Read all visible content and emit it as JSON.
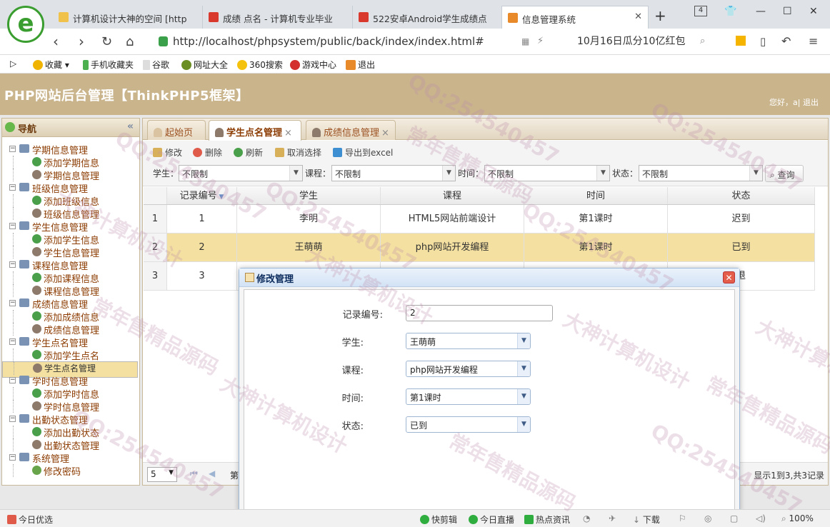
{
  "browser": {
    "tabs": [
      {
        "label": "计算机设计大神的空间 [http",
        "color": "#f0c14b"
      },
      {
        "label": "成绩 点名 - 计算机专业毕业",
        "color": "#d9382c"
      },
      {
        "label": "522安卓Android学生成绩点",
        "color": "#d9382c"
      },
      {
        "label": "信息管理系统",
        "color": "#e88a2a"
      }
    ],
    "new_tab": "+",
    "url": "http://localhost/phpsystem/public/back/index/index.html#",
    "search_text": "10月16日瓜分10亿红包",
    "bookmarks": [
      "收藏",
      "手机收藏夹",
      "谷歌",
      "网址大全",
      "360搜索",
      "游戏中心",
      "退出"
    ]
  },
  "app": {
    "title": "PHP网站后台管理【ThinkPHP5框架】",
    "greeting": "您好，a| 退出"
  },
  "nav": {
    "title": "导航",
    "groups": [
      {
        "label": "学期信息管理",
        "items": [
          "添加学期信息",
          "学期信息管理"
        ]
      },
      {
        "label": "班级信息管理",
        "items": [
          "添加班级信息",
          "班级信息管理"
        ]
      },
      {
        "label": "学生信息管理",
        "items": [
          "添加学生信息",
          "学生信息管理"
        ]
      },
      {
        "label": "课程信息管理",
        "items": [
          "添加课程信息",
          "课程信息管理"
        ]
      },
      {
        "label": "成绩信息管理",
        "items": [
          "添加成绩信息",
          "成绩信息管理"
        ]
      },
      {
        "label": "学生点名管理",
        "items": [
          "添加学生点名",
          "学生点名管理"
        ]
      },
      {
        "label": "学时信息管理",
        "items": [
          "添加学时信息",
          "学时信息管理"
        ]
      },
      {
        "label": "出勤状态管理",
        "items": [
          "添加出勤状态",
          "出勤状态管理"
        ]
      },
      {
        "label": "系统管理",
        "items": [
          "修改密码"
        ]
      }
    ],
    "selected": "学生点名管理"
  },
  "tabs": [
    {
      "label": "起始页",
      "closable": false
    },
    {
      "label": "学生点名管理",
      "closable": true
    },
    {
      "label": "成绩信息管理",
      "closable": true
    }
  ],
  "toolbar": {
    "edit": "修改",
    "delete": "删除",
    "refresh": "刷新",
    "cancel_select": "取消选择",
    "export": "导出到excel",
    "filter_student_label": "学生：",
    "filter_student_value": "不限制",
    "filter_course_label": "课程：",
    "filter_course_value": "不限制",
    "filter_time_label": "时间：",
    "filter_time_value": "不限制",
    "filter_status_label": "状态：",
    "filter_status_value": "不限制",
    "query": "查询"
  },
  "grid": {
    "headers": [
      "记录编号",
      "学生",
      "课程",
      "时间",
      "状态"
    ],
    "rows": [
      {
        "rn": "1",
        "cells": [
          "1",
          "李明",
          "HTML5网站前端设计",
          "第1课时",
          "迟到"
        ]
      },
      {
        "rn": "2",
        "cells": [
          "2",
          "王萌萌",
          "php网站开发编程",
          "第1课时",
          "已到"
        ]
      },
      {
        "rn": "3",
        "cells": [
          "3",
          "",
          "",
          "",
          "退"
        ]
      }
    ]
  },
  "pager": {
    "size": "5",
    "page_text": "第",
    "info": "显示1到3,共3记录"
  },
  "dialog": {
    "title": "修改管理",
    "fields": [
      {
        "label": "记录编号:",
        "value": "2"
      },
      {
        "label": "学生:",
        "value": "王萌萌"
      },
      {
        "label": "课程:",
        "value": "php网站开发编程"
      },
      {
        "label": "时间:",
        "value": "第1课时"
      },
      {
        "label": "状态:",
        "value": "已到"
      }
    ]
  },
  "statusbar": {
    "left": "今日优选",
    "items": [
      "快剪辑",
      "今日直播",
      "热点资讯",
      "下载"
    ],
    "zoom": "100%"
  },
  "watermarks": [
    "QQ:254540457",
    "大神计算机设计",
    "常年售精品源码"
  ]
}
